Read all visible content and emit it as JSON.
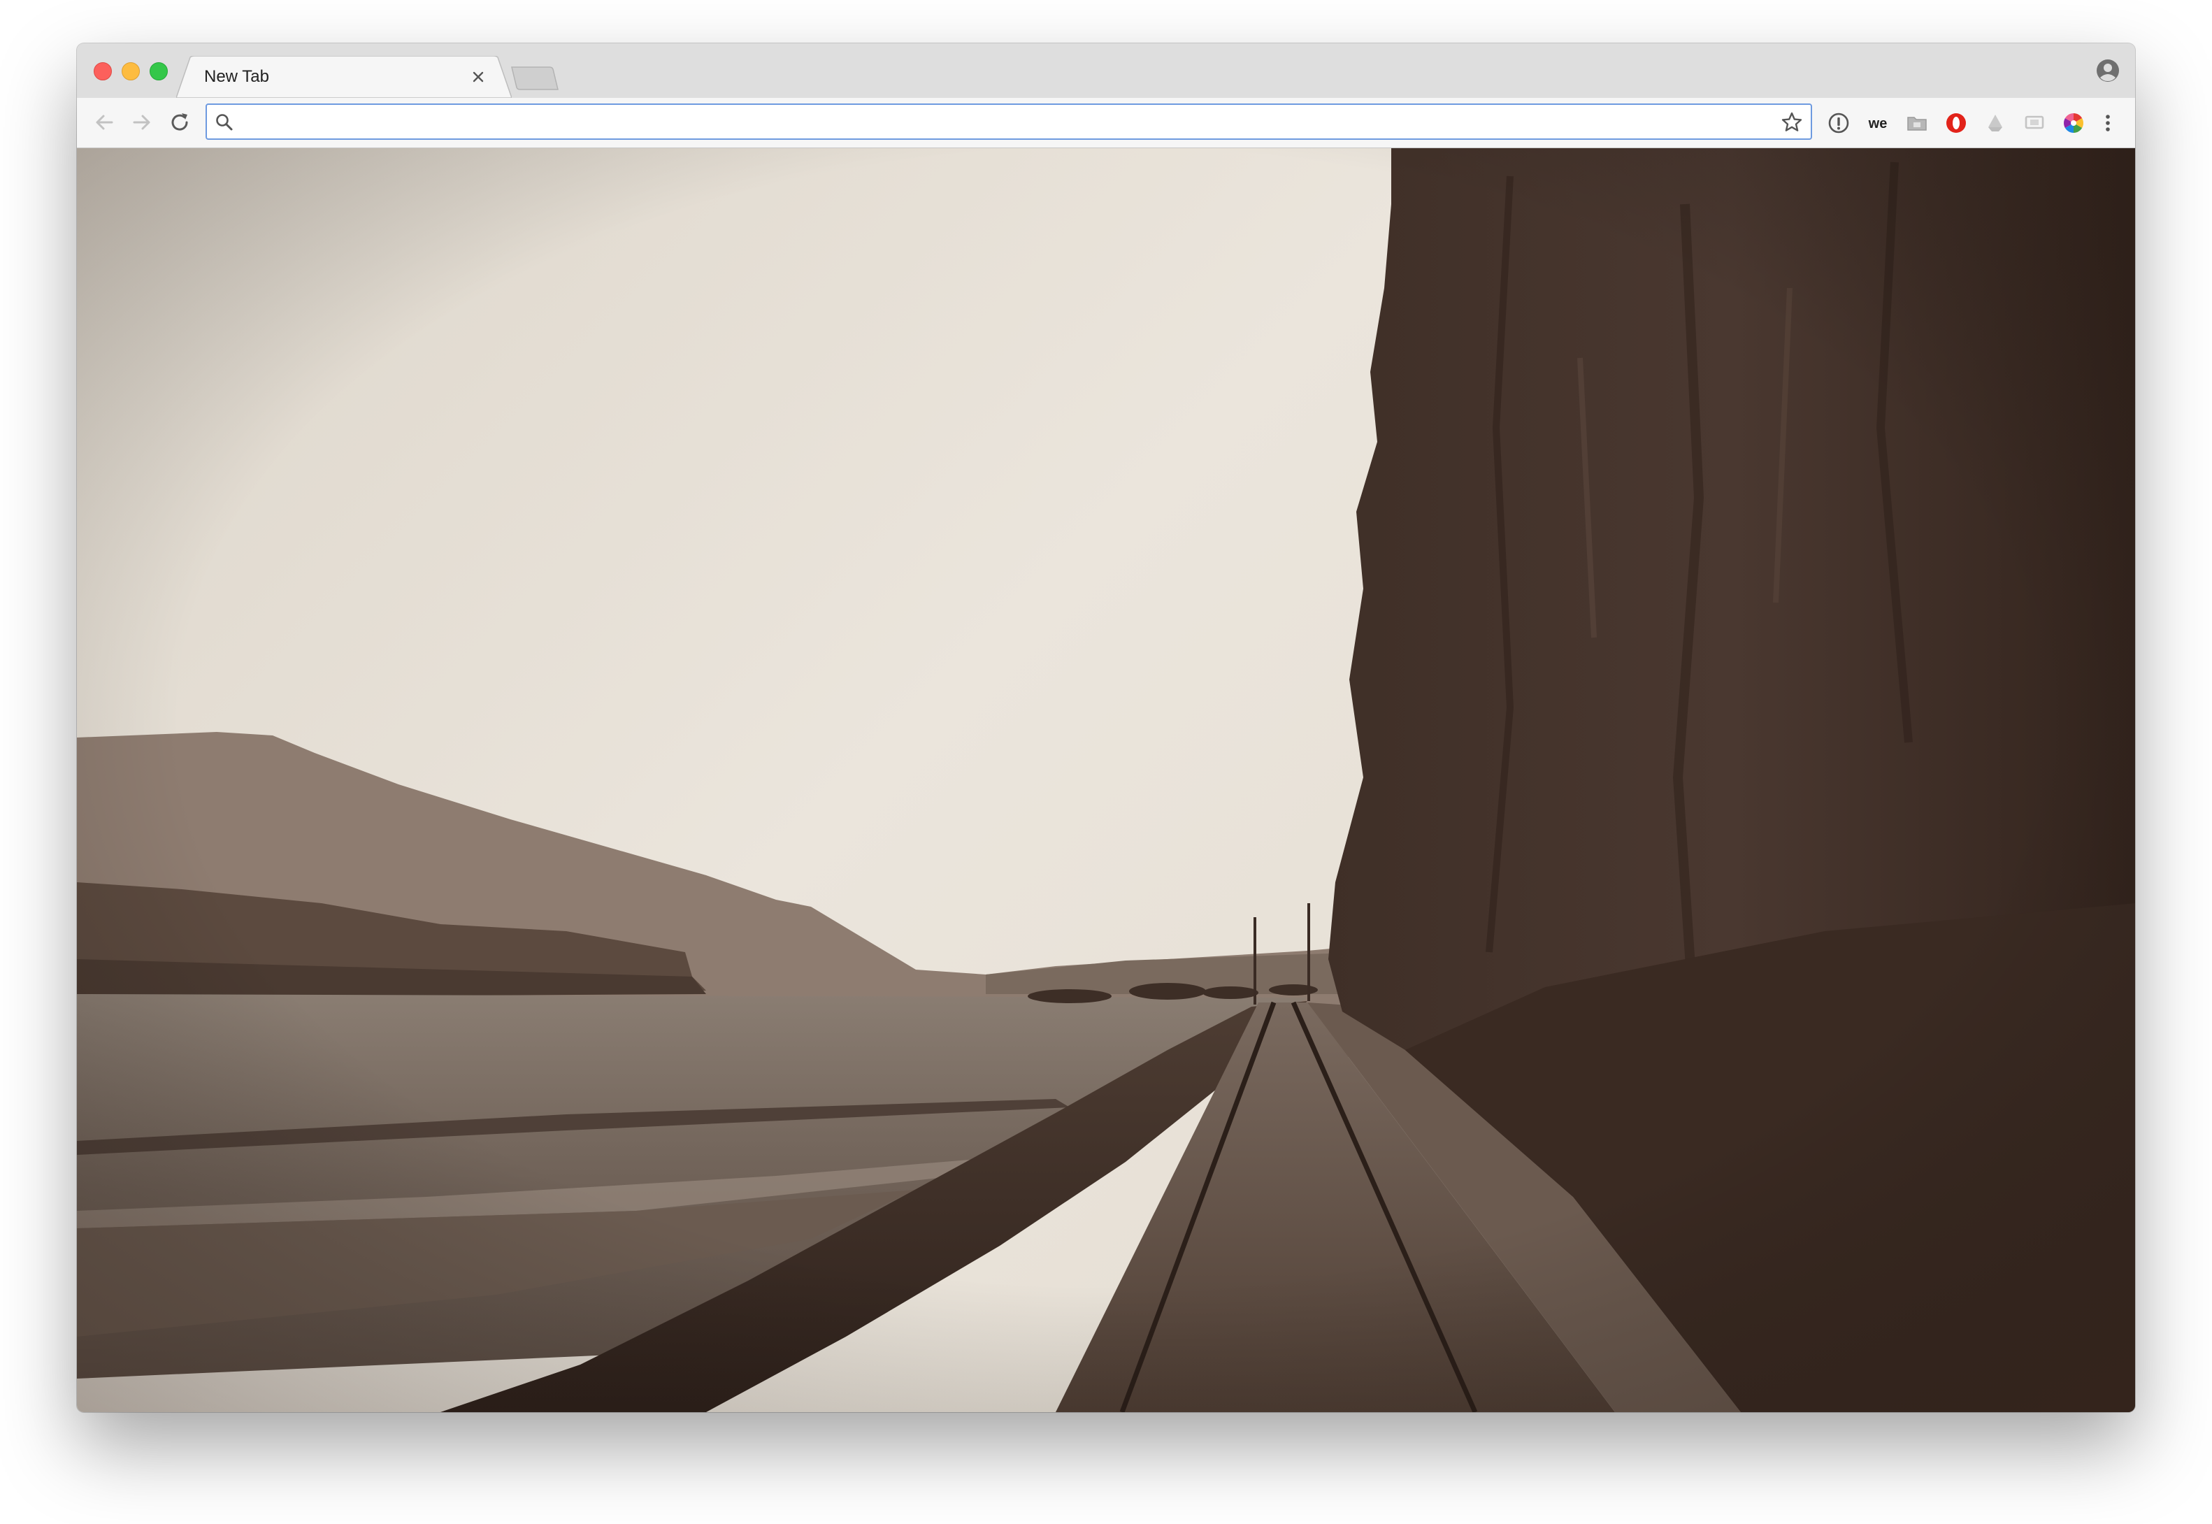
{
  "window": {
    "traffic_lights": [
      "close",
      "minimize",
      "maximize"
    ]
  },
  "tabs": [
    {
      "title": "New Tab",
      "active": true
    }
  ],
  "toolbar": {
    "back_icon": "arrow-left-icon",
    "forward_icon": "arrow-right-icon",
    "reload_icon": "reload-icon",
    "omnibox": {
      "value": "",
      "placeholder": "",
      "search_icon": "search-icon",
      "bookmark_icon": "star-icon"
    },
    "extensions": [
      "info-icon",
      "we-extension-icon",
      "folder-extension-icon",
      "opera-extension-icon",
      "cloud-extension-icon",
      "cast-extension-icon",
      "color-wheel-extension-icon"
    ],
    "menu_icon": "kebab-menu-icon"
  },
  "content": {
    "type": "background-photograph",
    "tone": "sepia",
    "subject": "railway-along-river-below-cliff"
  },
  "colors": {
    "tabstrip": "#dedede",
    "toolbar": "#f6f6f6",
    "omnibox_focus": "#6e9ae0",
    "close": "#fc605c",
    "minimize": "#fdbc40",
    "maximize": "#34c749"
  }
}
